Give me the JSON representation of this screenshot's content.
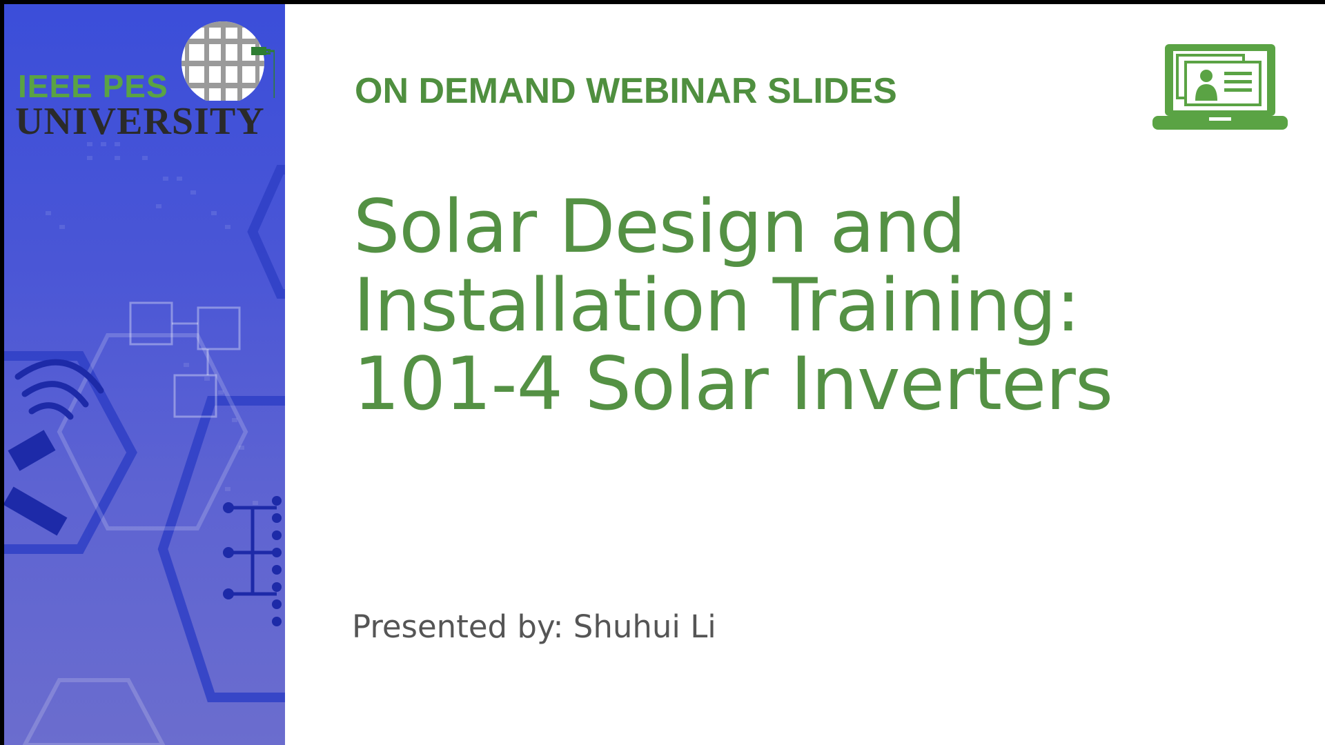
{
  "slide": {
    "kicker": "ON DEMAND WEBINAR SLIDES",
    "title_lines": [
      "Solar Design and",
      "Installation Training:",
      "101-4 Solar Inverters"
    ],
    "presenter": "Presented by: Shuhui Li"
  },
  "logo": {
    "line1": "IEEE PES",
    "line2": "UNIVERSITY"
  },
  "icons": {
    "webinar": "laptop-presenter-icon",
    "globe": "globe-icon"
  },
  "colors": {
    "accent_green": "#549144",
    "panel_blue": "#4a56d6",
    "presenter_text": "#555555",
    "university_text": "#2a2a2a"
  }
}
